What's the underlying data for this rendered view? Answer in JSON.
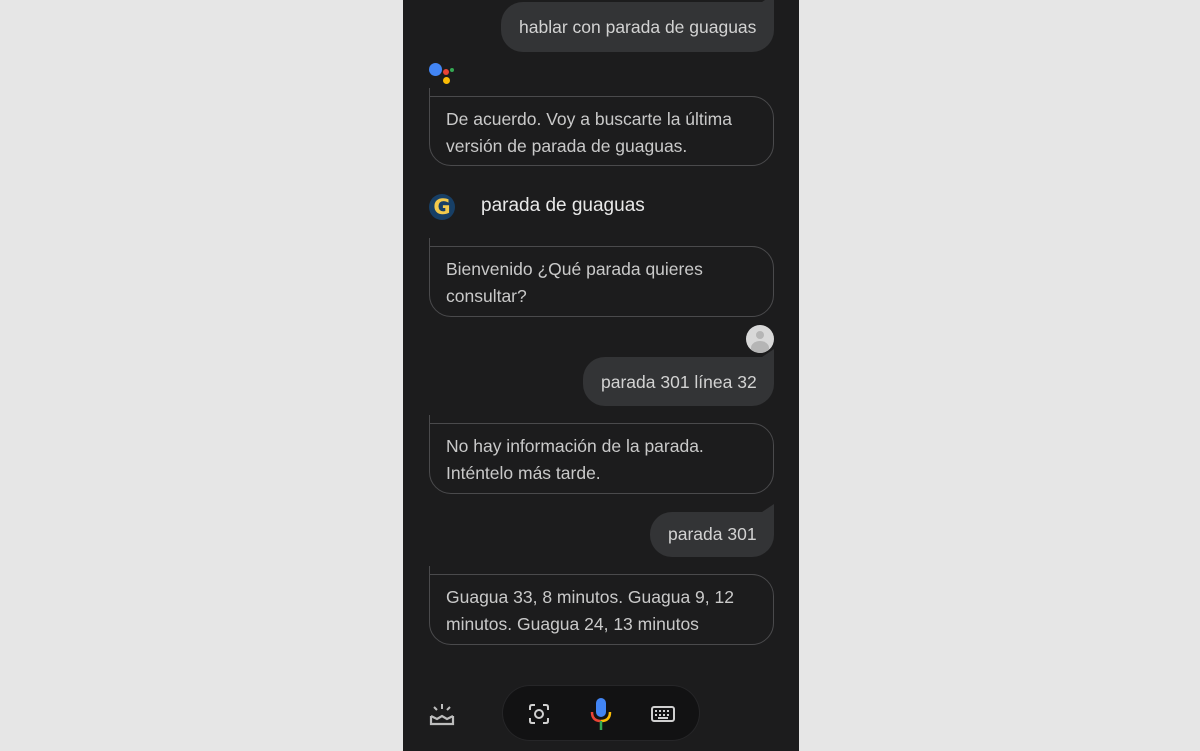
{
  "conversation": {
    "user_msg_1": "hablar con parada de guaguas",
    "assistant_msg_1": "De acuerdo. Voy a buscarte la última versión de parada de guaguas.",
    "action_name": "parada de guaguas",
    "action_msg_1": "Bienvenido ¿Qué parada quieres consultar?",
    "user_msg_2": "parada 301 línea 32",
    "action_msg_2": "No hay información de la parada. Inténtelo más tarde.",
    "user_msg_3": "parada 301",
    "action_msg_3": "Guagua 33, 8 minutos. Guagua 9, 12 minutos. Guagua 24, 13 minutos"
  },
  "icons": {
    "assistant": "google-assistant-icon",
    "action": "action-g-icon",
    "avatar": "user-avatar-icon",
    "snapshot": "snapshot-icon",
    "lens": "lens-icon",
    "mic": "mic-icon",
    "keyboard": "keyboard-icon"
  },
  "colors": {
    "background": "#1c1c1d",
    "user_bubble": "#333436",
    "google_blue": "#4285f4",
    "google_red": "#ea4335",
    "google_yellow": "#fbbc05",
    "google_green": "#34a853"
  }
}
